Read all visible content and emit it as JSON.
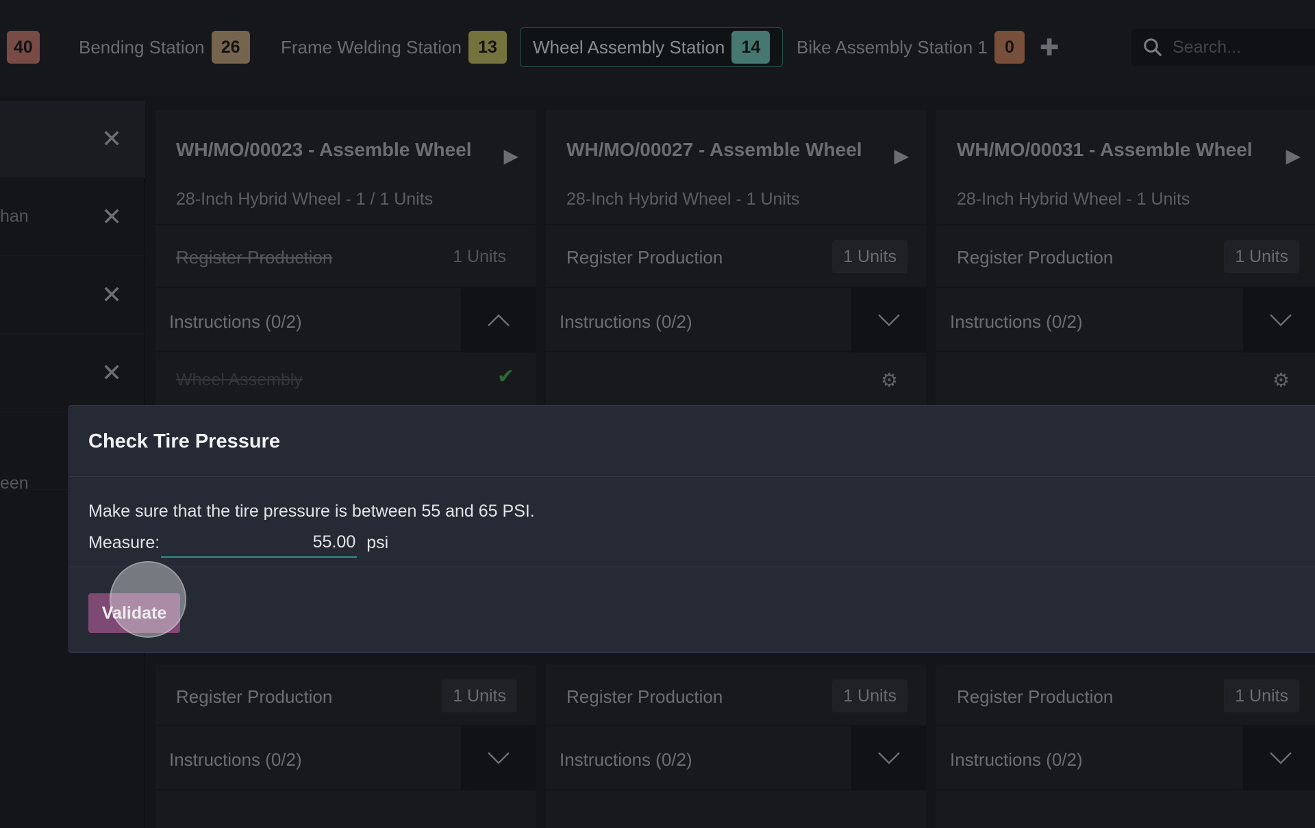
{
  "tabs": [
    {
      "label": "",
      "count": "40"
    },
    {
      "label": "Bending Station",
      "count": "26"
    },
    {
      "label": "Frame Welding Station",
      "count": "13"
    },
    {
      "label": "Wheel Assembly Station",
      "count": "14"
    },
    {
      "label": "Bike Assembly Station 1",
      "count": "0"
    }
  ],
  "search": {
    "placeholder": "Search..."
  },
  "sidebar": {
    "items": [
      {
        "label": ""
      },
      {
        "label": "han"
      },
      {
        "label": ""
      },
      {
        "label": ""
      },
      {
        "label": "een"
      }
    ]
  },
  "cards": [
    {
      "title": "WH/MO/00023 - Assemble Wheel",
      "subtitle": "28-Inch Hybrid Wheel - 1 / 1 Units",
      "register_label": "Register Production",
      "register_units": "1 Units",
      "instructions": "Instructions (0/2)",
      "step_label": "Wheel Assembly"
    },
    {
      "title": "WH/MO/00027 - Assemble Wheel",
      "subtitle": "28-Inch Hybrid Wheel - 1 Units",
      "register_label": "Register Production",
      "register_units": "1 Units",
      "instructions": "Instructions (0/2)"
    },
    {
      "title": "WH/MO/00031 - Assemble Wheel",
      "subtitle": "28-Inch Hybrid Wheel - 1 Units",
      "register_label": "Register Production",
      "register_units": "1 Units",
      "instructions": "Instructions (0/2)"
    }
  ],
  "lower_cards": [
    {
      "register_label": "Register Production",
      "register_units": "1 Units",
      "instructions": "Instructions (0/2)"
    },
    {
      "register_label": "Register Production",
      "register_units": "1 Units",
      "instructions": "Instructions (0/2)"
    },
    {
      "register_label": "Register Production",
      "register_units": "1 Units",
      "instructions": "Instructions (0/2)"
    }
  ],
  "dialog": {
    "title": "Check Tire Pressure",
    "description": "Make sure that the tire pressure is between 55 and 65 PSI.",
    "measure_label": "Measure:",
    "measure_value": "55.00",
    "measure_unit": "psi",
    "validate_label": "Validate"
  },
  "colors": {
    "accent_teal": "#2e8f86",
    "validate_purple": "#7e4a74",
    "check_green": "#3d8a4b"
  }
}
